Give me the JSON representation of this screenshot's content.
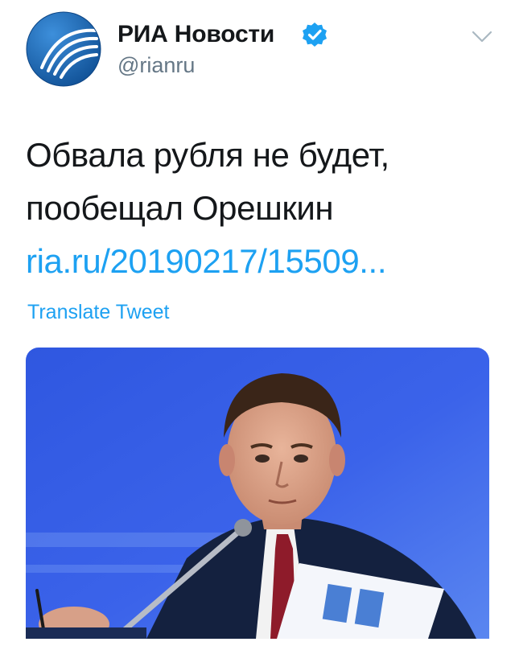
{
  "account": {
    "display_name": "РИА Новости",
    "handle": "@rianru",
    "verified_icon": "verified-badge-icon",
    "menu_icon": "chevron-down-icon"
  },
  "tweet": {
    "text_lines": [
      "Обвала рубля не будет,",
      "пообещал Орешкин"
    ],
    "link": "ria.ru/20190217/15509...",
    "translate_label": "Translate Tweet"
  },
  "colors": {
    "accent": "#1da1f2",
    "text": "#14171a",
    "secondary": "#657786",
    "logo_blue": "#1a6bb8"
  }
}
